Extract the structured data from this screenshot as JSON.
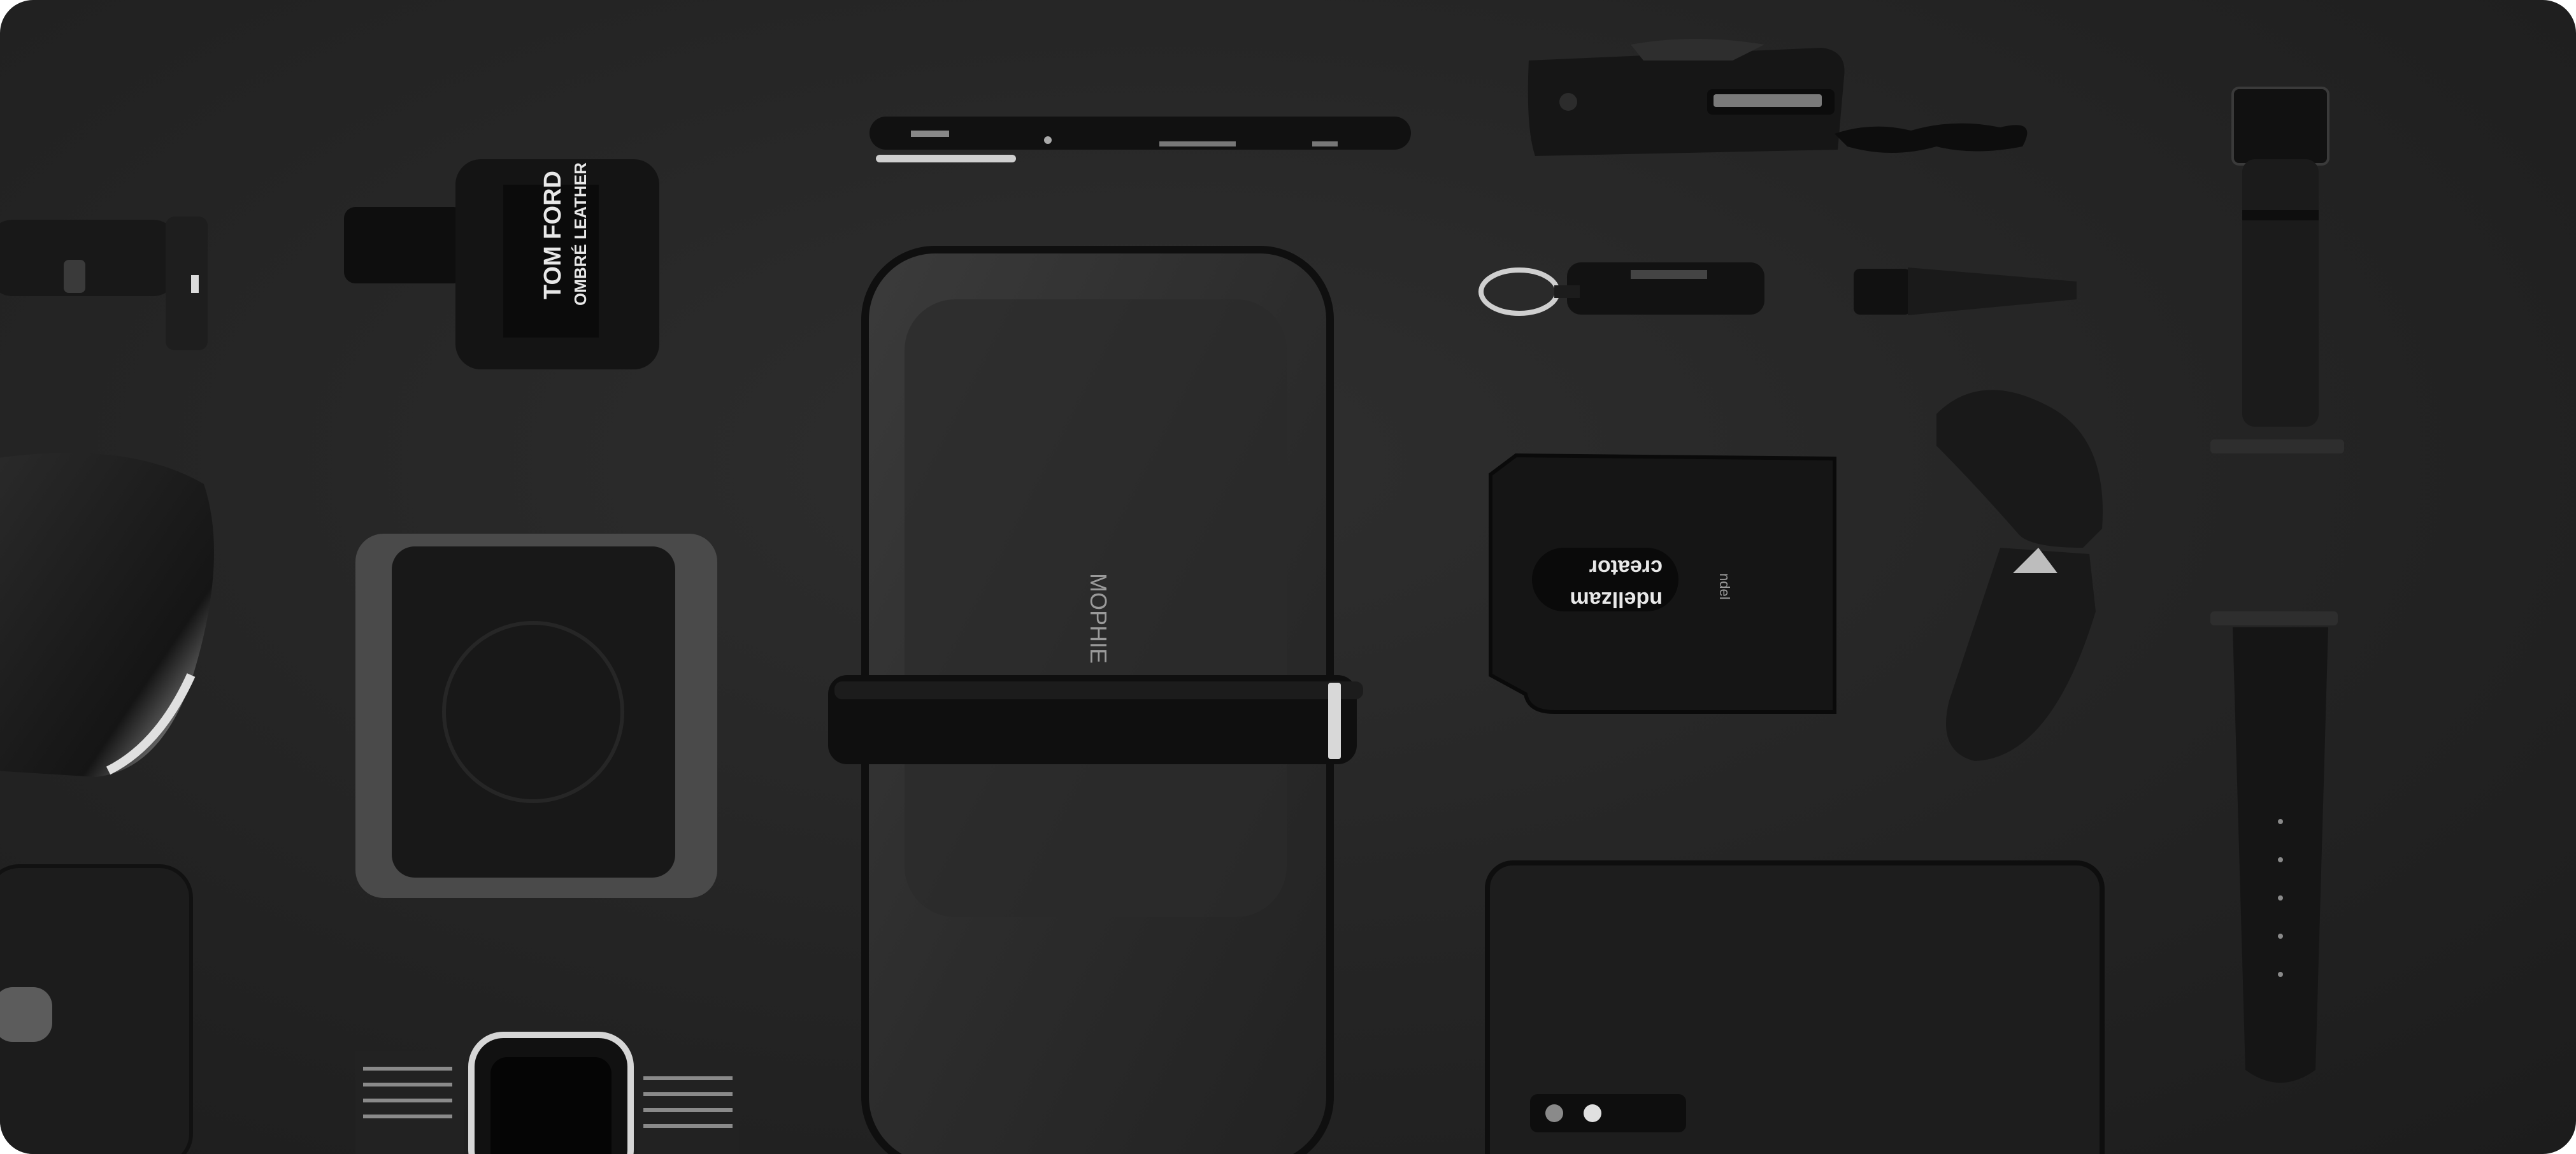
{
  "photo": {
    "subject": "flat-lay product photo on dark background",
    "palette": {
      "background": "#272727",
      "object_dark": "#141414",
      "object_mid": "#333333",
      "highlight": "#bfbfbf"
    }
  },
  "labels": {
    "perfume_line1": "TOM FORD",
    "perfume_line2": "OMBRÉ LEATHER",
    "wallet_line1": "creator",
    "wallet_line2": "ndellzam"
  }
}
